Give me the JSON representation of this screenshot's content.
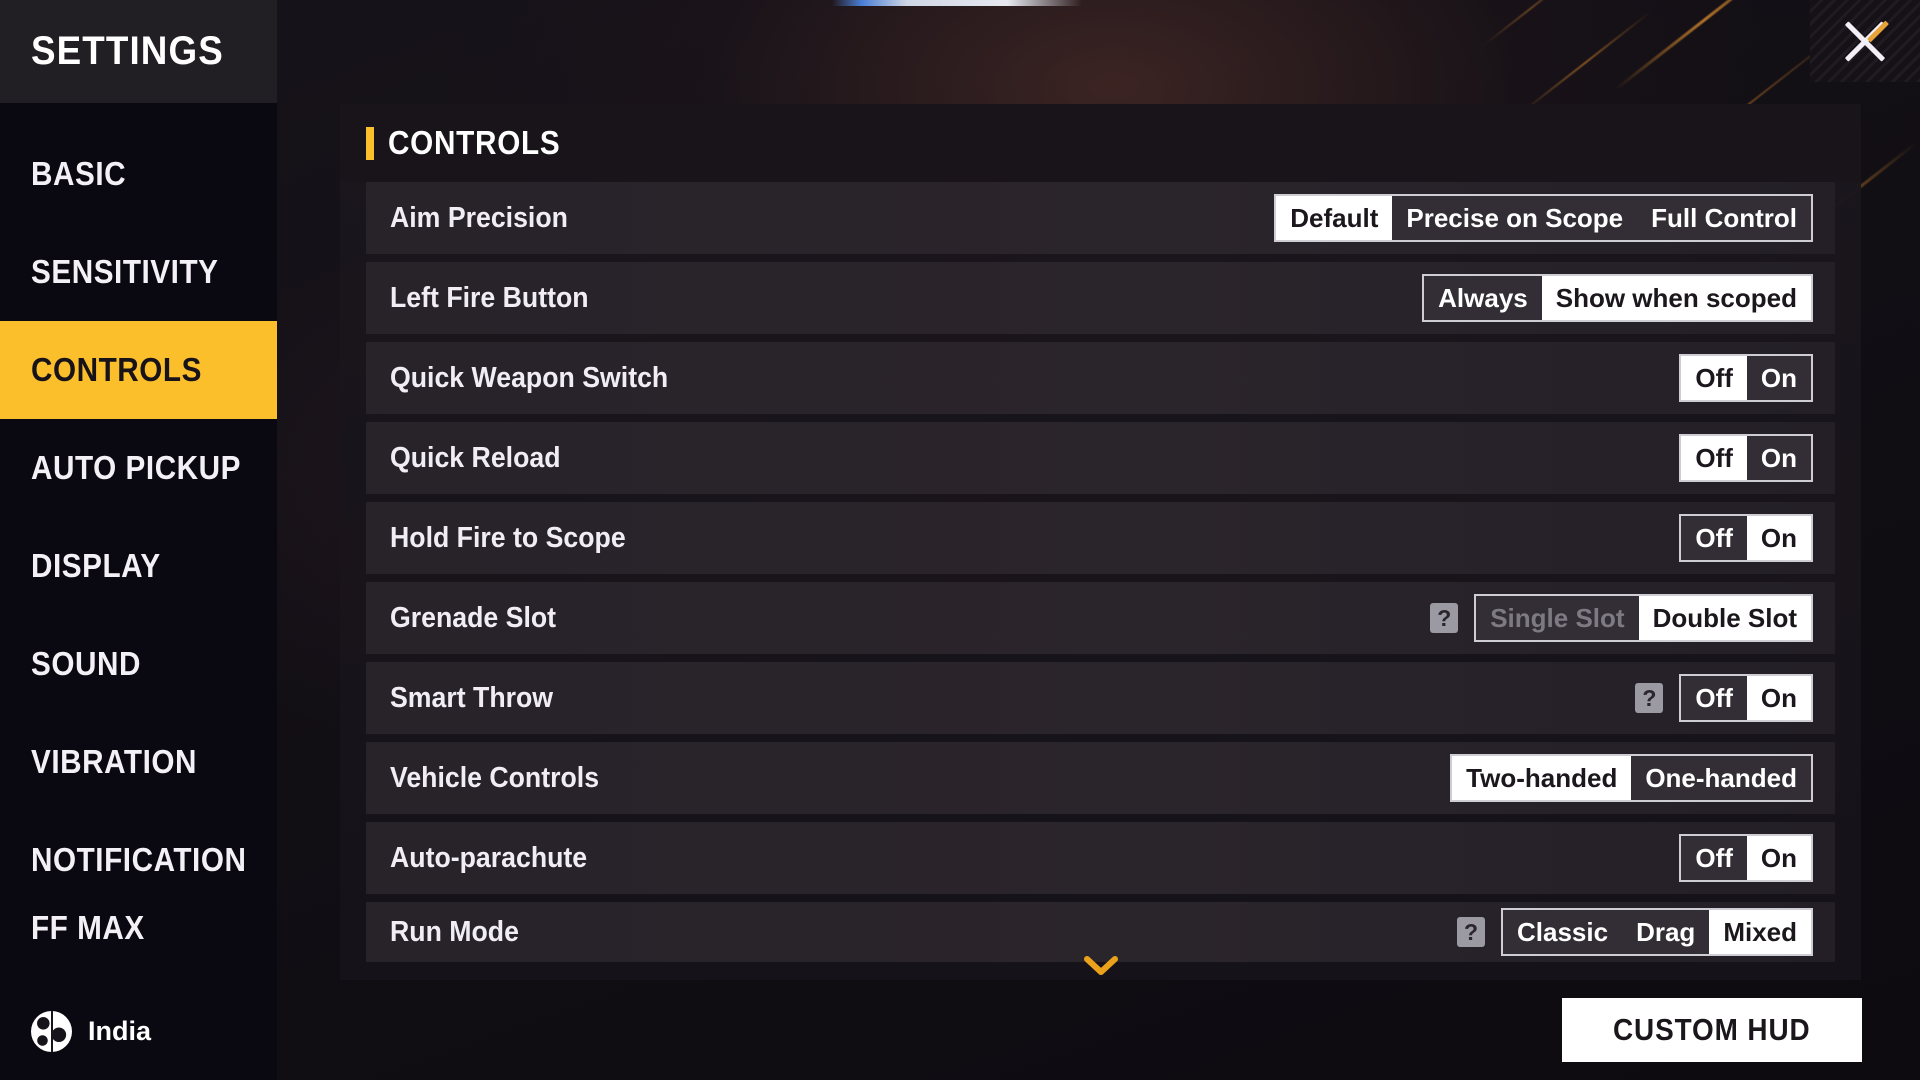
{
  "sidebar": {
    "title": "SETTINGS",
    "items": [
      {
        "label": "BASIC",
        "active": false
      },
      {
        "label": "SENSITIVITY",
        "active": false
      },
      {
        "label": "CONTROLS",
        "active": true
      },
      {
        "label": "AUTO PICKUP",
        "active": false
      },
      {
        "label": "DISPLAY",
        "active": false
      },
      {
        "label": "SOUND",
        "active": false
      },
      {
        "label": "VIBRATION",
        "active": false
      },
      {
        "label": "NOTIFICATION",
        "active": false
      },
      {
        "label": "FF MAX",
        "active": false
      }
    ],
    "region": {
      "label": "India",
      "icon": "globe-icon"
    }
  },
  "header": {
    "title": "CONTROLS",
    "accent_color": "#fbbf2b"
  },
  "close_button": {
    "icon": "close-icon"
  },
  "scroll_indicator": {
    "icon": "chevron-down-icon",
    "color": "#fbbf2b"
  },
  "settings": [
    {
      "label": "Aim Precision",
      "help": false,
      "options": [
        {
          "text": "Default",
          "selected": true,
          "disabled": false
        },
        {
          "text": "Precise on Scope",
          "selected": false,
          "disabled": false
        },
        {
          "text": "Full Control",
          "selected": false,
          "disabled": false
        }
      ]
    },
    {
      "label": "Left Fire Button",
      "help": false,
      "options": [
        {
          "text": "Always",
          "selected": false,
          "disabled": false
        },
        {
          "text": "Show when scoped",
          "selected": true,
          "disabled": false
        }
      ]
    },
    {
      "label": "Quick Weapon Switch",
      "help": false,
      "options": [
        {
          "text": "Off",
          "selected": true,
          "disabled": false
        },
        {
          "text": "On",
          "selected": false,
          "disabled": false
        }
      ]
    },
    {
      "label": "Quick Reload",
      "help": false,
      "options": [
        {
          "text": "Off",
          "selected": true,
          "disabled": false
        },
        {
          "text": "On",
          "selected": false,
          "disabled": false
        }
      ]
    },
    {
      "label": "Hold Fire to Scope",
      "help": false,
      "options": [
        {
          "text": "Off",
          "selected": false,
          "disabled": false
        },
        {
          "text": "On",
          "selected": true,
          "disabled": false
        }
      ]
    },
    {
      "label": "Grenade Slot",
      "help": true,
      "options": [
        {
          "text": "Single Slot",
          "selected": false,
          "disabled": true
        },
        {
          "text": "Double Slot",
          "selected": true,
          "disabled": false
        }
      ]
    },
    {
      "label": "Smart Throw",
      "help": true,
      "options": [
        {
          "text": "Off",
          "selected": false,
          "disabled": false
        },
        {
          "text": "On",
          "selected": true,
          "disabled": false
        }
      ]
    },
    {
      "label": "Vehicle Controls",
      "help": false,
      "options": [
        {
          "text": "Two-handed",
          "selected": true,
          "disabled": false
        },
        {
          "text": "One-handed",
          "selected": false,
          "disabled": false
        }
      ]
    },
    {
      "label": "Auto-parachute",
      "help": false,
      "options": [
        {
          "text": "Off",
          "selected": false,
          "disabled": false
        },
        {
          "text": "On",
          "selected": true,
          "disabled": false
        }
      ]
    },
    {
      "label": "Run Mode",
      "help": true,
      "options": [
        {
          "text": "Classic",
          "selected": false,
          "disabled": false
        },
        {
          "text": "Drag",
          "selected": false,
          "disabled": false
        },
        {
          "text": "Mixed",
          "selected": true,
          "disabled": false
        }
      ]
    }
  ],
  "footer": {
    "custom_hud_label": "CUSTOM HUD"
  }
}
